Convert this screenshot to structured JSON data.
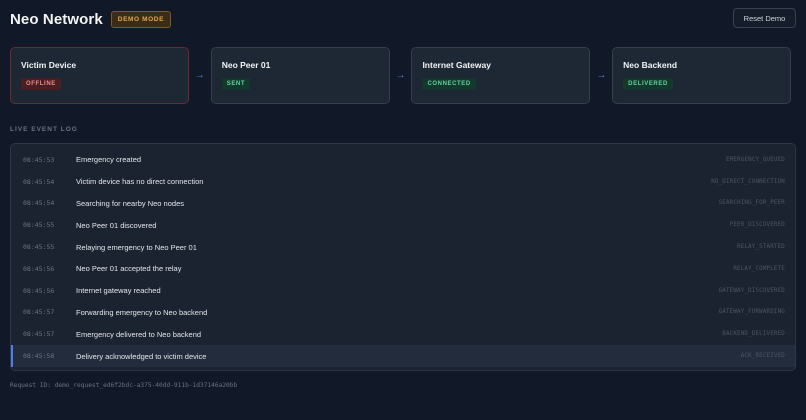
{
  "header": {
    "title": "Neo Network",
    "mode_badge": "DEMO MODE",
    "reset_label": "Reset Demo"
  },
  "flow": {
    "nodes": [
      {
        "title": "Victim Device",
        "status": "OFFLINE"
      },
      {
        "title": "Neo Peer 01",
        "status": "SENT"
      },
      {
        "title": "Internet Gateway",
        "status": "CONNECTED"
      },
      {
        "title": "Neo Backend",
        "status": "DELIVERED"
      }
    ]
  },
  "log": {
    "label": "LIVE EVENT LOG",
    "entries": [
      {
        "time": "08:45:53",
        "message": "Emergency created",
        "code": "EMERGENCY_QUEUED"
      },
      {
        "time": "08:45:54",
        "message": "Victim device has no direct connection",
        "code": "NO_DIRECT_CONNECTION"
      },
      {
        "time": "08:45:54",
        "message": "Searching for nearby Neo nodes",
        "code": "SEARCHING_FOR_PEER"
      },
      {
        "time": "08:45:55",
        "message": "Neo Peer 01 discovered",
        "code": "PEER_DISCOVERED"
      },
      {
        "time": "08:45:55",
        "message": "Relaying emergency to Neo Peer 01",
        "code": "RELAY_STARTED"
      },
      {
        "time": "08:45:56",
        "message": "Neo Peer 01 accepted the relay",
        "code": "RELAY_COMPLETE"
      },
      {
        "time": "08:45:56",
        "message": "Internet gateway reached",
        "code": "GATEWAY_DISCOVERED"
      },
      {
        "time": "08:45:57",
        "message": "Forwarding emergency to Neo backend",
        "code": "GATEWAY_FORWARDING"
      },
      {
        "time": "08:45:57",
        "message": "Emergency delivered to Neo backend",
        "code": "BACKEND_DELIVERED"
      },
      {
        "time": "08:45:58",
        "message": "Delivery acknowledged to victim device",
        "code": "ACK_RECEIVED"
      }
    ]
  },
  "request_id": "Request ID: demo_request_ed6f2bdc-a375-40dd-911b-1d37146a20bb"
}
